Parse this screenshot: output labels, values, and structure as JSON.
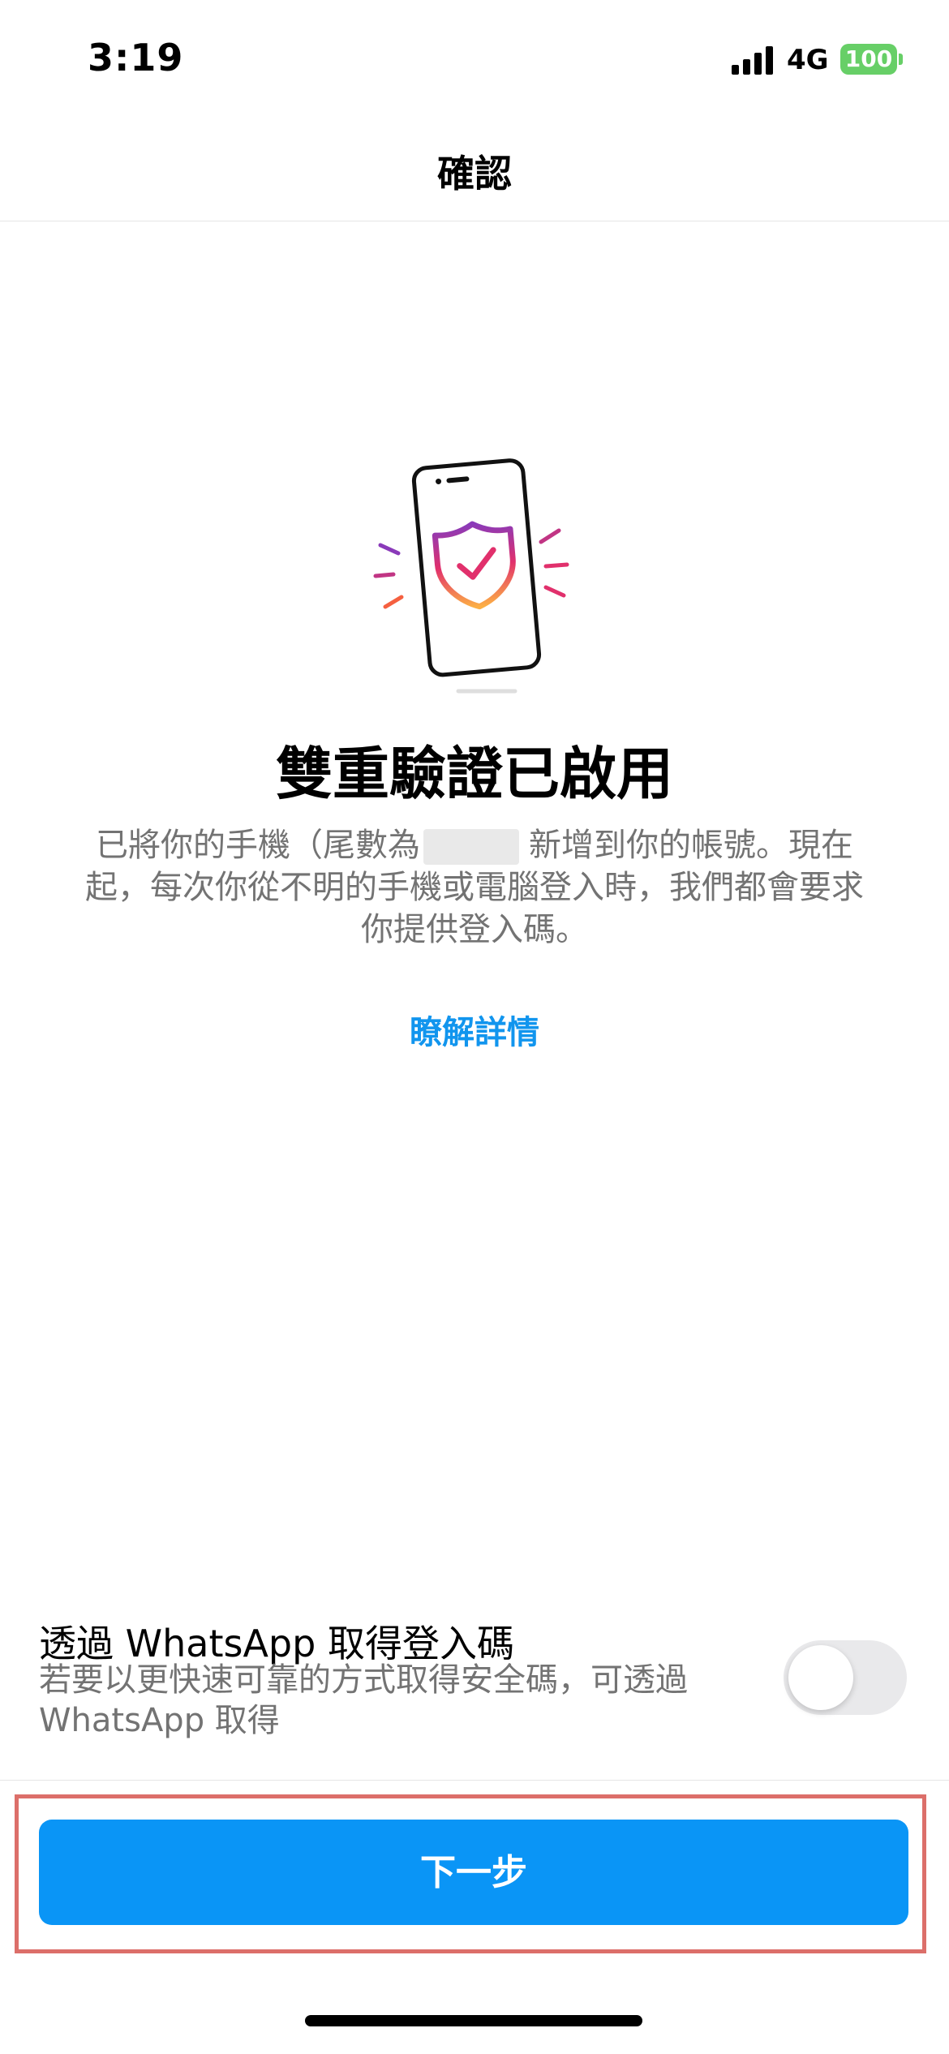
{
  "status_bar": {
    "time": "3:19",
    "network": "4G",
    "battery": "100"
  },
  "nav": {
    "title": "確認"
  },
  "main": {
    "headline": "雙重驗證已啟用",
    "description_part1": "已將你的手機（尾數為",
    "description_part2": "新增到你的帳號。現在起，每次你從不明的手機或電腦登入時，我們都會要求你提供登入碼。",
    "learn_more": "瞭解詳情"
  },
  "whatsapp": {
    "title": "透過 WhatsApp 取得登入碼",
    "subtitle": "若要以更快速可靠的方式取得安全碼，可透過 WhatsApp 取得",
    "toggle_on": false
  },
  "footer": {
    "next_label": "下一步"
  },
  "icons": {
    "illustration": "phone-shield-check-icon",
    "signal": "cellular-signal-icon",
    "battery": "battery-icon"
  },
  "colors": {
    "accent": "#0a95f6",
    "link": "#1195ee",
    "highlight": "#dc6f6a",
    "battery": "#67cf67"
  }
}
